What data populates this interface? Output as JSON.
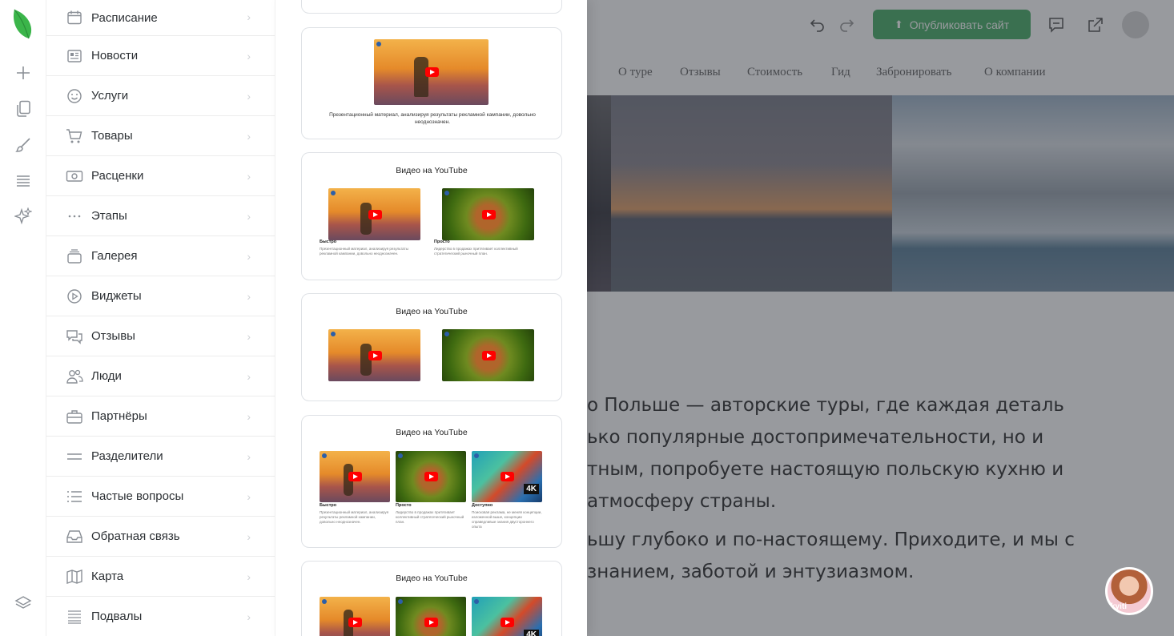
{
  "rail": {
    "icons": [
      "logo-leaf",
      "plus-icon",
      "pages-icon",
      "brush-icon",
      "sections-icon",
      "sparkles-icon",
      "layers-icon"
    ]
  },
  "categories": [
    {
      "label": "Расписание",
      "icon": "calendar-icon"
    },
    {
      "label": "Новости",
      "icon": "newspaper-icon"
    },
    {
      "label": "Услуги",
      "icon": "smile-icon"
    },
    {
      "label": "Товары",
      "icon": "cart-icon"
    },
    {
      "label": "Расценки",
      "icon": "banknote-icon"
    },
    {
      "label": "Этапы",
      "icon": "dots-icon"
    },
    {
      "label": "Галерея",
      "icon": "gallery-icon"
    },
    {
      "label": "Виджеты",
      "icon": "play-circle-icon"
    },
    {
      "label": "Отзывы",
      "icon": "chat-bubbles-icon"
    },
    {
      "label": "Люди",
      "icon": "people-icon"
    },
    {
      "label": "Партнёры",
      "icon": "briefcase-icon"
    },
    {
      "label": "Разделители",
      "icon": "divider-icon"
    },
    {
      "label": "Частые вопросы",
      "icon": "list-icon"
    },
    {
      "label": "Обратная связь",
      "icon": "inbox-icon"
    },
    {
      "label": "Карта",
      "icon": "map-icon"
    },
    {
      "label": "Подвалы",
      "icon": "footer-icon"
    }
  ],
  "templates": {
    "card1": {
      "subtitle": "Презентационный материал, анализируя результаты рекламной кампании, довольно неоднозначен."
    },
    "card2": {
      "title": "Видео на YouTube",
      "captions": [
        "Быстро",
        "Просто"
      ],
      "descs": [
        "Презентационный материал, анализируя результаты рекламной кампании, довольно неоднозначен.",
        "Лидерство в продажах притягивает коллективный стратегический рыночный план."
      ]
    },
    "card3": {
      "title": "Видео на YouTube"
    },
    "card4": {
      "title": "Видео на YouTube",
      "captions": [
        "Быстро",
        "Просто",
        "Доступно"
      ],
      "descs": [
        "Презентационный материал, анализируя результаты рекламной кампании, довольно неоднозначен.",
        "Лидерство в продажах притягивает коллективный стратегический рыночный план.",
        "Поисковая реклама, не меняя концепции, изложенной выше, концепции справедливые знания двустороннего опыта"
      ]
    },
    "card5": {
      "title": "Видео на YouTube"
    },
    "badge_4k": "4K"
  },
  "preview": {
    "publish_label": "Опубликовать сайт",
    "nav": [
      "О туре",
      "Отзывы",
      "Стоимость",
      "Гид",
      "Забронировать",
      "О компании"
    ],
    "text_lines": [
      "о Польше — авторские туры, где каждая деталь",
      "ько популярные достопримечательности, но и",
      "тным, попробуете настоящую польскую кухню и",
      " атмосферу страны.",
      "ьшу глубоко и по-настоящему. Приходите, и мы с",
      "знанием, заботой и энтузиазмом."
    ],
    "chat_label": "kyiti"
  }
}
